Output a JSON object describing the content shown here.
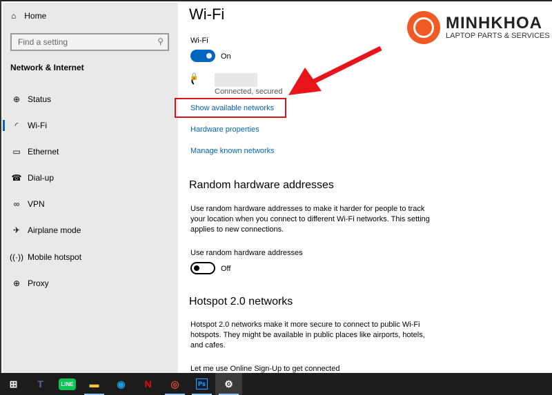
{
  "sidebar": {
    "home": "Home",
    "search_placeholder": "Find a setting",
    "section": "Network & Internet",
    "items": [
      {
        "label": "Status",
        "icon": "globe-monitor-icon"
      },
      {
        "label": "Wi-Fi",
        "icon": "wifi-icon",
        "selected": true
      },
      {
        "label": "Ethernet",
        "icon": "ethernet-icon"
      },
      {
        "label": "Dial-up",
        "icon": "dialup-icon"
      },
      {
        "label": "VPN",
        "icon": "vpn-icon"
      },
      {
        "label": "Airplane mode",
        "icon": "airplane-icon"
      },
      {
        "label": "Mobile hotspot",
        "icon": "hotspot-icon"
      },
      {
        "label": "Proxy",
        "icon": "globe-icon"
      }
    ]
  },
  "main": {
    "title": "Wi-Fi",
    "wifi_label": "Wi-Fi",
    "wifi_state": "On",
    "network_status": "Connected, secured",
    "links": [
      "Show available networks",
      "Hardware properties",
      "Manage known networks"
    ],
    "random_title": "Random hardware addresses",
    "random_desc": "Use random hardware addresses to make it harder for people to track your location when you connect to different Wi-Fi networks. This setting applies to new connections.",
    "random_label": "Use random hardware addresses",
    "random_state": "Off",
    "hotspot_title": "Hotspot 2.0 networks",
    "hotspot_desc": "Hotspot 2.0 networks make it more secure to connect to public Wi-Fi hotspots. They might be available in public places like airports, hotels, and cafes.",
    "signup": "Let me use Online Sign-Up to get connected"
  },
  "logo": {
    "name": "MINHKHOA",
    "tagline": "LAPTOP PARTS & SERVICES",
    "color": "#f15a22"
  },
  "annotation_color": "#d6141a",
  "taskbar": [
    "windows-start",
    "teams",
    "line",
    "file-explorer",
    "edge",
    "netflix",
    "chrome",
    "photoshop",
    "settings"
  ]
}
